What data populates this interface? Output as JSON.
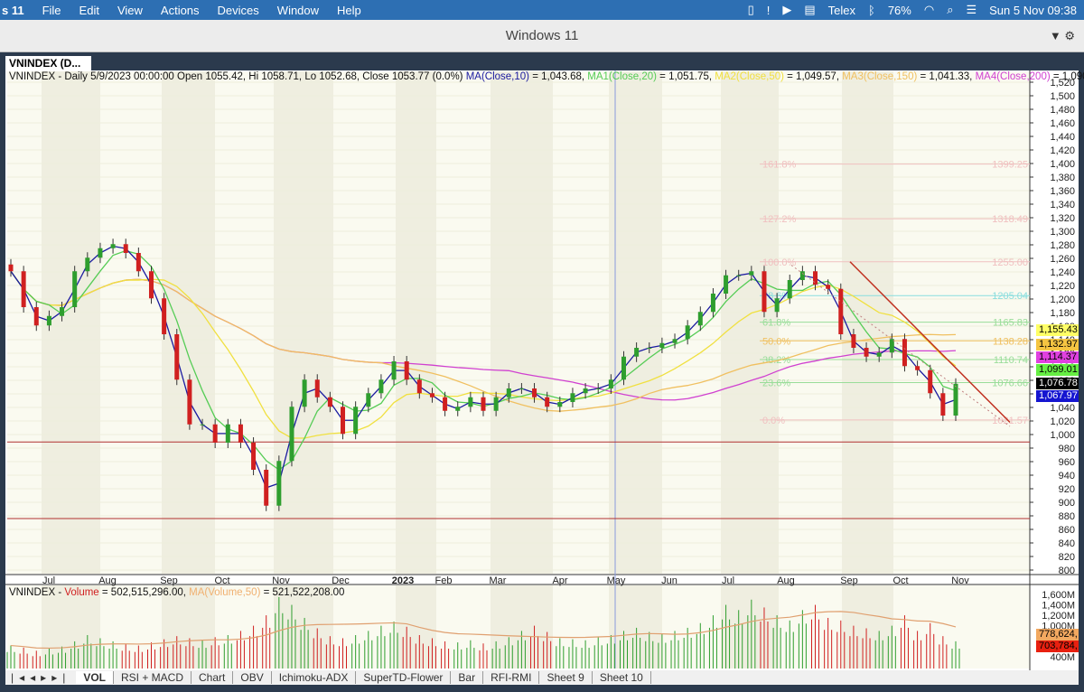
{
  "menubar": {
    "app": "s 11",
    "items": [
      "File",
      "Edit",
      "View",
      "Actions",
      "Devices",
      "Window",
      "Help"
    ],
    "telex": "Telex",
    "battery": "76%",
    "clock": "Sun 5 Nov  09:38"
  },
  "window": {
    "title": "Windows 11"
  },
  "tab_title": "VNINDEX (D...",
  "info": {
    "prefix": "VNINDEX - Daily 5/9/2023 00:00:00 Open 1055.42, Hi 1058.71, Lo 1052.68, Close 1053.77 (0.0%)",
    "ma10": "MA(Close,10)",
    "ma10v": " = 1,043.68, ",
    "ma20": "MA1(Close,20)",
    "ma20v": " = 1,051.75, ",
    "ma50": "MA2(Close,50)",
    "ma50v": " = 1,049.57, ",
    "ma150": "MA3(Close,150)",
    "ma150v": " = 1,041.33, ",
    "ma200": "MA4(Close,200)",
    "ma200v": " = 1,090"
  },
  "vinfo": {
    "prefix": "VNINDEX - ",
    "vol": "Volume",
    "volv": " = 502,515,296.00, ",
    "ma": "MA(Volume,50)",
    "mav": " = 521,522,208.00"
  },
  "badges": [
    {
      "text": "1,155.43",
      "bg": "#ffff66",
      "fg": "#000",
      "value": 1155.43
    },
    {
      "text": "1,132.97",
      "bg": "#f5c542",
      "fg": "#000",
      "value": 1132.97
    },
    {
      "text": "1,114.37",
      "bg": "#e040e0",
      "fg": "#000",
      "value": 1114.37
    },
    {
      "text": "1,099.01",
      "bg": "#66ee44",
      "fg": "#000",
      "value": 1099.01
    },
    {
      "text": "1,076.78",
      "bg": "#000",
      "fg": "#fff",
      "value": 1076.78
    },
    {
      "text": "1,067.97",
      "bg": "#1515d0",
      "fg": "#fff",
      "value": 1067.97
    }
  ],
  "vbadges": [
    {
      "text": "778,624,",
      "bg": "#f2a860",
      "fg": "#000"
    },
    {
      "text": "703,784,",
      "bg": "#e82010",
      "fg": "#000"
    }
  ],
  "tabs": [
    "VOL",
    "RSI + MACD",
    "Chart",
    "OBV",
    "Ichimoku-ADX",
    "SuperTD-Flower",
    "Bar",
    "RFI-RMI",
    "Sheet 9",
    "Sheet 10"
  ],
  "colors": {
    "up": "#2e9e2e",
    "down": "#d02020",
    "ma10": "#1a1aa0",
    "ma20": "#55cc55",
    "ma50": "#f0e040",
    "ma150": "#f0c060",
    "ma200": "#d040d0",
    "fib": "#88cccc"
  },
  "chart_data": [
    {
      "type": "candlestick",
      "ylim": [
        800,
        1520
      ],
      "yticks": [
        1520,
        1500,
        1480,
        1460,
        1440,
        1420,
        1400,
        1380,
        1360,
        1340,
        1320,
        1300,
        1280,
        1260,
        1240,
        1220,
        1200,
        1180,
        1160,
        1140,
        1120,
        1100,
        1080,
        1060,
        1040,
        1020,
        1000,
        980,
        960,
        940,
        920,
        900,
        880,
        860,
        840,
        820,
        800
      ],
      "xticks": [
        "Jul",
        "Aug",
        "Sep",
        "Oct",
        "Nov",
        "Dec",
        "2023",
        "Feb",
        "Mar",
        "Apr",
        "May",
        "Jun",
        "Jul",
        "Aug",
        "Sep",
        "Oct",
        "Nov"
      ],
      "closes": [
        1241,
        1188,
        1161,
        1175,
        1188,
        1241,
        1261,
        1275,
        1281,
        1268,
        1241,
        1201,
        1148,
        1081,
        1015,
        1015,
        988,
        1015,
        988,
        948,
        895,
        961,
        1041,
        1081,
        1055,
        1041,
        1001,
        1041,
        1061,
        1081,
        1108,
        1081,
        1061,
        1055,
        1035,
        1041,
        1055,
        1035,
        1055,
        1068,
        1068,
        1055,
        1041,
        1048,
        1061,
        1068,
        1068,
        1081,
        1115,
        1128,
        1128,
        1135,
        1141,
        1161,
        1181,
        1208,
        1235,
        1235,
        1241,
        1181,
        1201,
        1228,
        1241,
        1221,
        1215,
        1148,
        1128,
        1115,
        1121,
        1141,
        1101,
        1095,
        1061,
        1028,
        1075
      ],
      "fibonacci": [
        {
          "label": "161.8%",
          "value": "1399.25",
          "v": 1399.25
        },
        {
          "label": "127.2%",
          "value": "1318.49",
          "v": 1318.49
        },
        {
          "label": "100.0%",
          "value": "1255.00",
          "v": 1255
        },
        {
          "label": "78.6%",
          "value": "1205.04",
          "v": 1205.04
        },
        {
          "label": "61.8%",
          "value": "1165.83",
          "v": 1165.83
        },
        {
          "label": "50.0%",
          "value": "1138.28",
          "v": 1138.28
        },
        {
          "label": "38.2%",
          "value": "1110.74",
          "v": 1110.74
        },
        {
          "label": "23.6%",
          "value": "1076.66",
          "v": 1076.66
        },
        {
          "label": "0.0%",
          "value": "1021.57",
          "v": 1021.57
        }
      ],
      "support_lines": [
        989,
        876
      ]
    },
    {
      "type": "bar",
      "ylim": [
        300,
        1700
      ],
      "yticks": [
        "1,600M",
        "1,400M",
        "1,200M",
        "1,000M",
        "800M",
        "600M",
        "400M"
      ],
      "ytick_values": [
        1600,
        1400,
        1200,
        1000,
        800,
        600,
        400
      ],
      "volumes_m": [
        620,
        580,
        520,
        560,
        600,
        700,
        820,
        760,
        700,
        650,
        620,
        680,
        740,
        800,
        760,
        720,
        780,
        820,
        900,
        1000,
        1200,
        1550,
        1400,
        1150,
        950,
        800,
        760,
        820,
        900,
        1000,
        1080,
        980,
        820,
        760,
        700,
        680,
        720,
        660,
        700,
        780,
        900,
        1000,
        880,
        760,
        740,
        720,
        780,
        820,
        900,
        960,
        880,
        840,
        900,
        960,
        1050,
        1200,
        1400,
        1300,
        1500,
        1350,
        1200,
        1100,
        1300,
        1400,
        1150,
        1100,
        1000,
        950,
        900,
        1000,
        1200,
        900,
        1050,
        800,
        700
      ]
    }
  ]
}
